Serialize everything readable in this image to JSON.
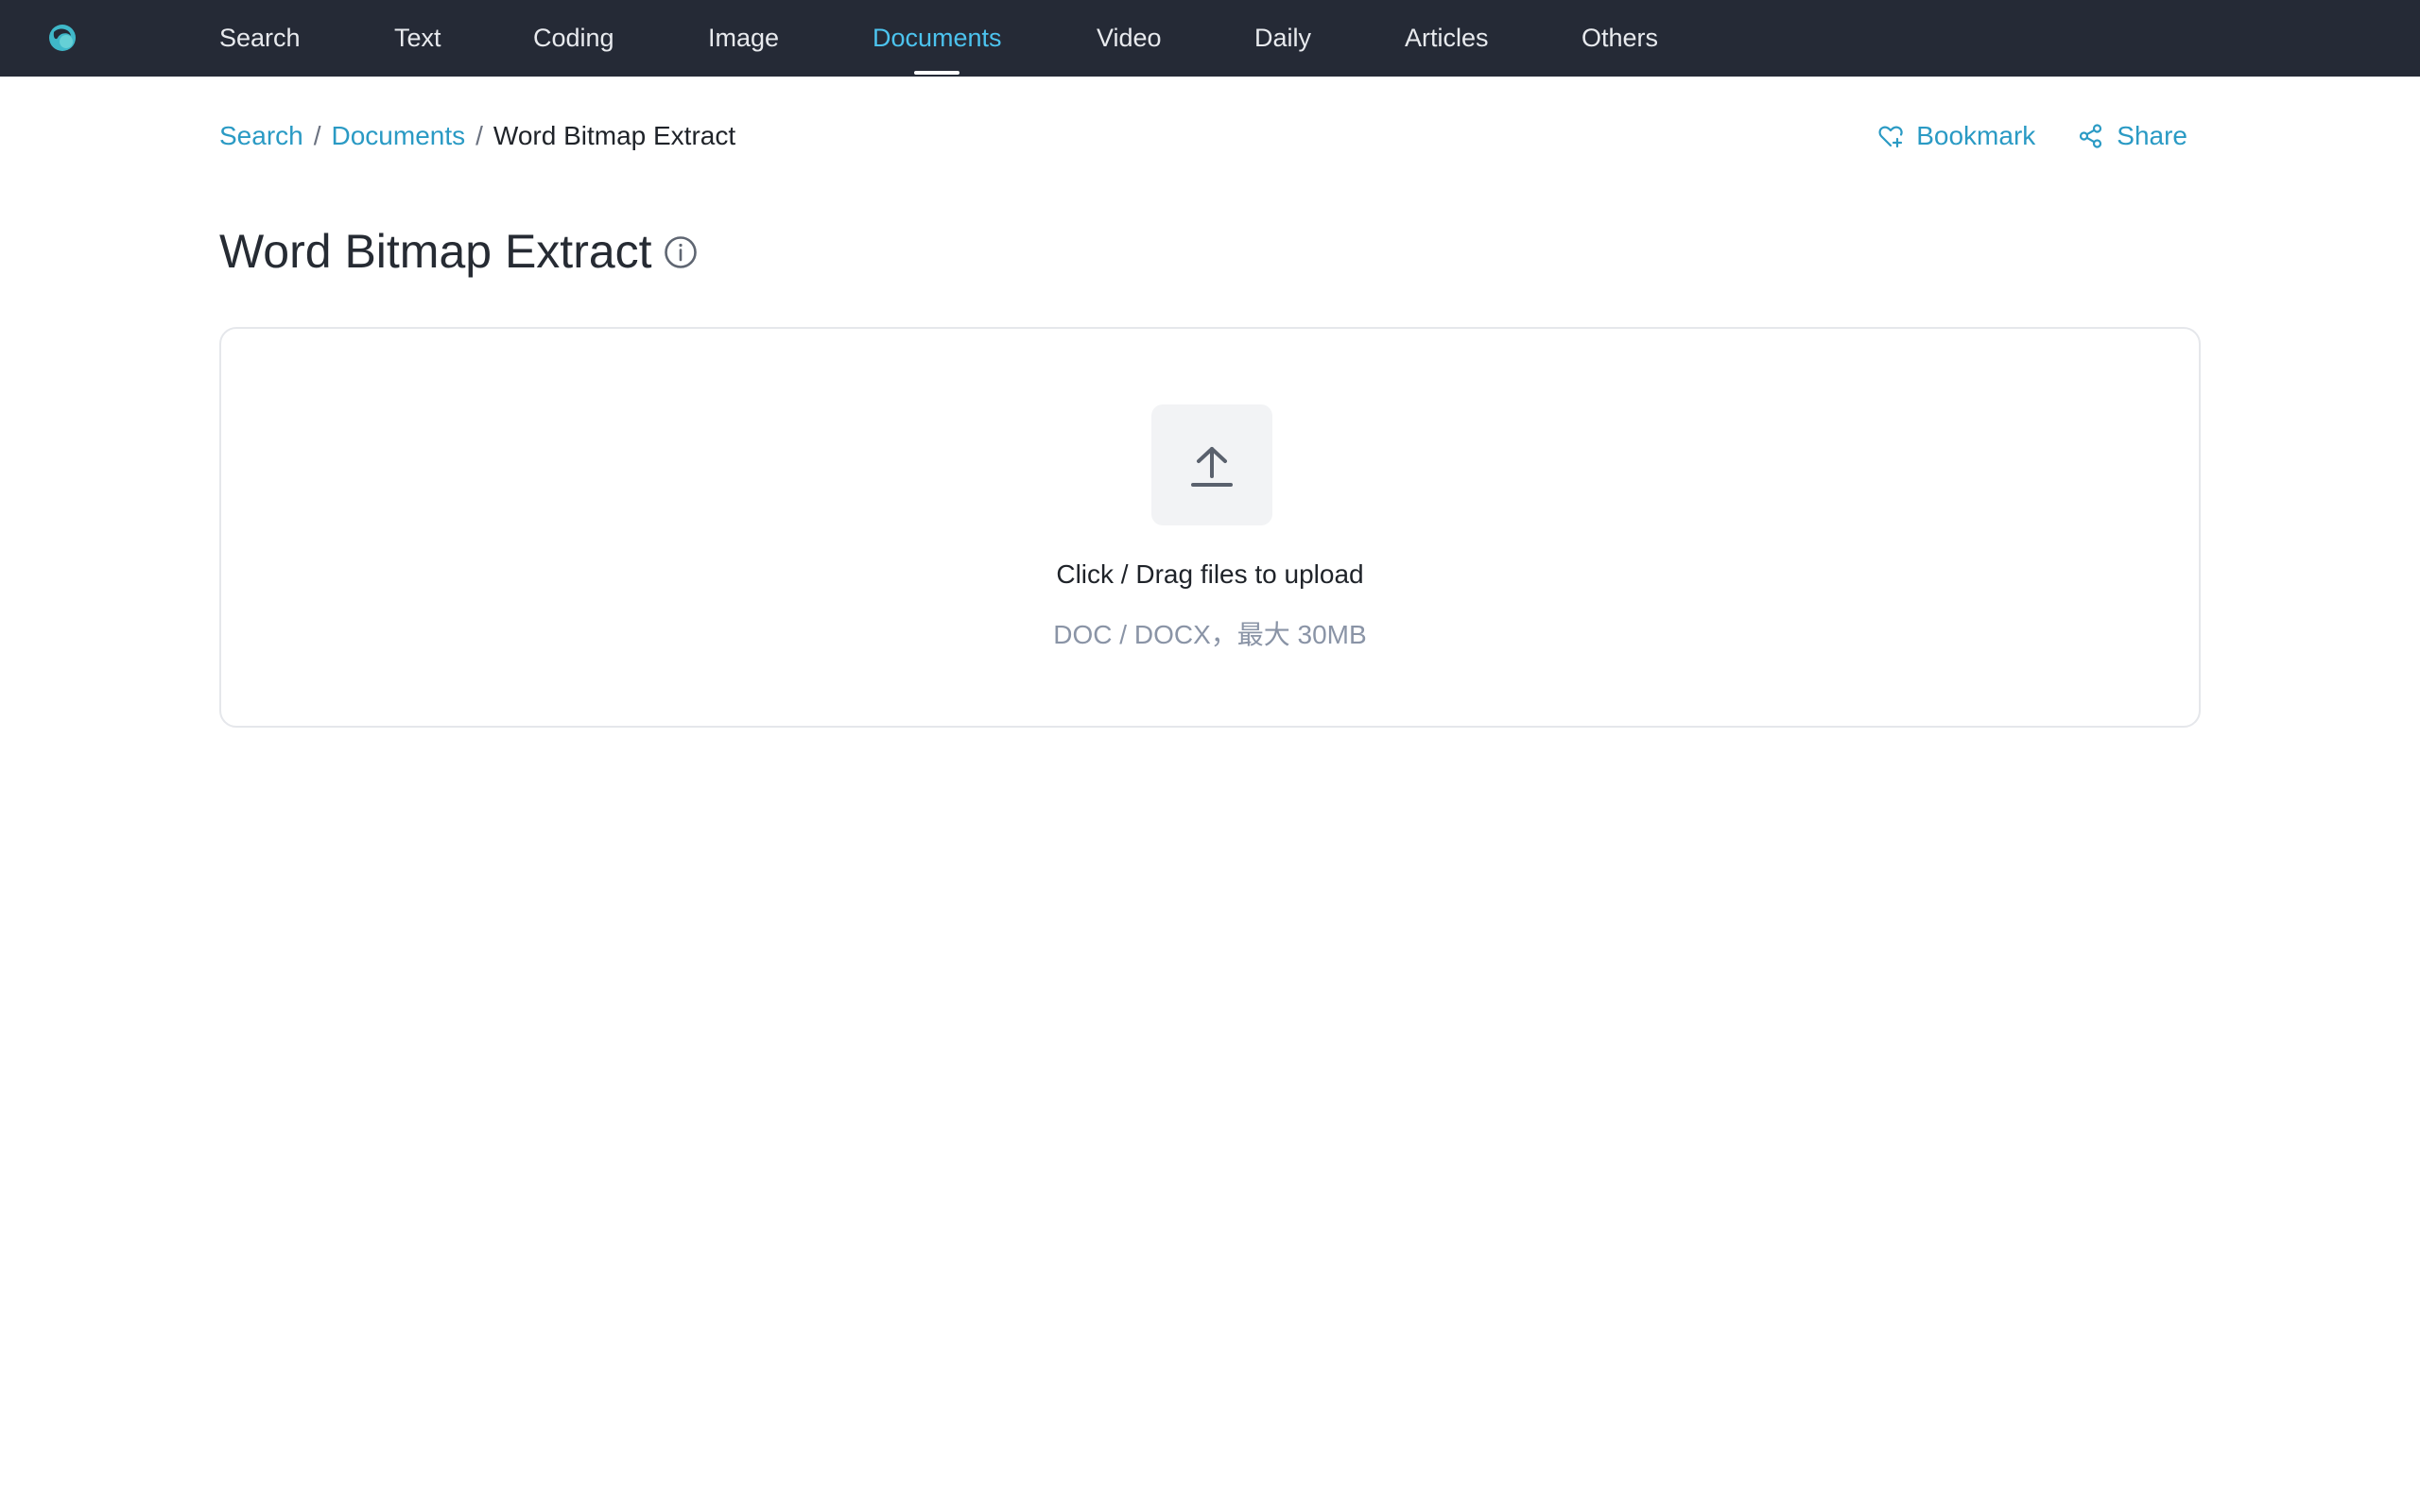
{
  "nav": {
    "logo_icon": "seal-logo-icon",
    "items": [
      {
        "label": "Search"
      },
      {
        "label": "Text"
      },
      {
        "label": "Coding"
      },
      {
        "label": "Image"
      },
      {
        "label": "Documents",
        "active": true
      },
      {
        "label": "Video"
      },
      {
        "label": "Daily"
      },
      {
        "label": "Articles"
      },
      {
        "label": "Others"
      }
    ]
  },
  "breadcrumb": {
    "items": [
      {
        "label": "Search"
      },
      {
        "label": "Documents"
      }
    ],
    "current": "Word Bitmap Extract",
    "separator": "/"
  },
  "actions": {
    "bookmark": {
      "label": "Bookmark",
      "icon": "heart-plus-icon"
    },
    "share": {
      "label": "Share",
      "icon": "share-icon"
    }
  },
  "page": {
    "title": "Word Bitmap Extract",
    "info_icon": "info-icon"
  },
  "upload": {
    "icon": "upload-arrow-icon",
    "primary_text": "Click / Drag files to upload",
    "secondary_text": "DOC / DOCX，最大 30MB"
  },
  "colors": {
    "nav_bg": "#252a36",
    "accent": "#4cc3ee",
    "link": "#2a9ac4"
  }
}
